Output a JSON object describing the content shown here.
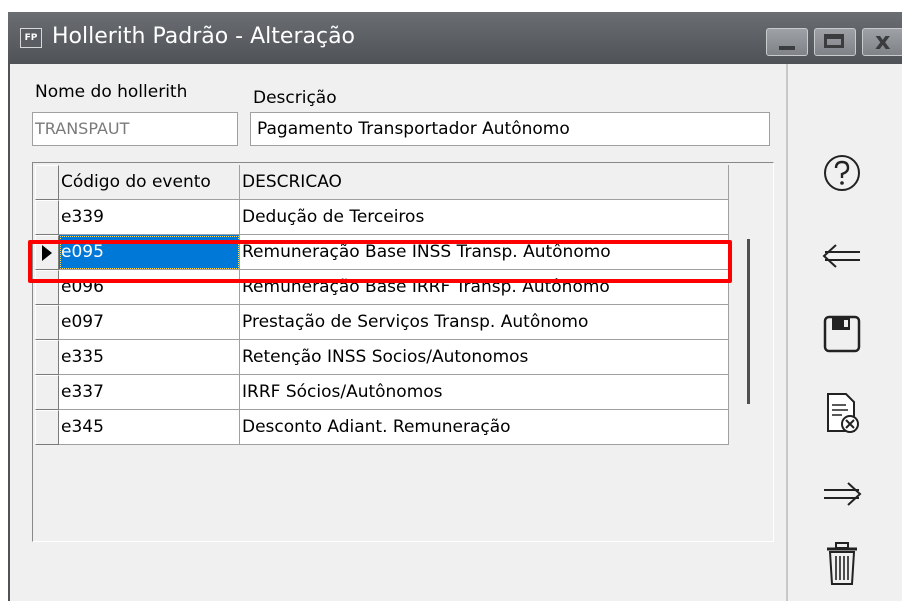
{
  "window": {
    "app_icon": "FP",
    "title": "Hollerith Padrão - Alteração"
  },
  "form": {
    "nome_label": "Nome do hollerith",
    "nome_value": "TRANSPAUT",
    "descricao_label": "Descrição",
    "descricao_value": "Pagamento Transportador Autônomo"
  },
  "grid": {
    "columns": [
      "Código do evento",
      "DESCRICAO"
    ],
    "rows": [
      {
        "codigo": "e339",
        "descricao": "Dedução de Terceiros"
      },
      {
        "codigo": "e095",
        "descricao": "Remuneração Base INSS Transp. Autônomo"
      },
      {
        "codigo": "e096",
        "descricao": "Remuneração Base IRRF Transp. Autônomo"
      },
      {
        "codigo": "e097",
        "descricao": "Prestação de Serviços Transp. Autônomo"
      },
      {
        "codigo": "e335",
        "descricao": "Retenção INSS Socios/Autonomos"
      },
      {
        "codigo": "e337",
        "descricao": "IRRF Sócios/Autônomos"
      },
      {
        "codigo": "e345",
        "descricao": "Desconto Adiant. Remuneração"
      }
    ],
    "selected_row": 1
  },
  "toolbar": {
    "icons": [
      "help-icon",
      "back-arrow-icon",
      "save-icon",
      "cancel-document-icon",
      "forward-arrow-icon",
      "trash-icon"
    ]
  },
  "colors": {
    "titlebar": "#5a5e62",
    "selection": "#0078d7",
    "highlight": "#ff0000"
  }
}
